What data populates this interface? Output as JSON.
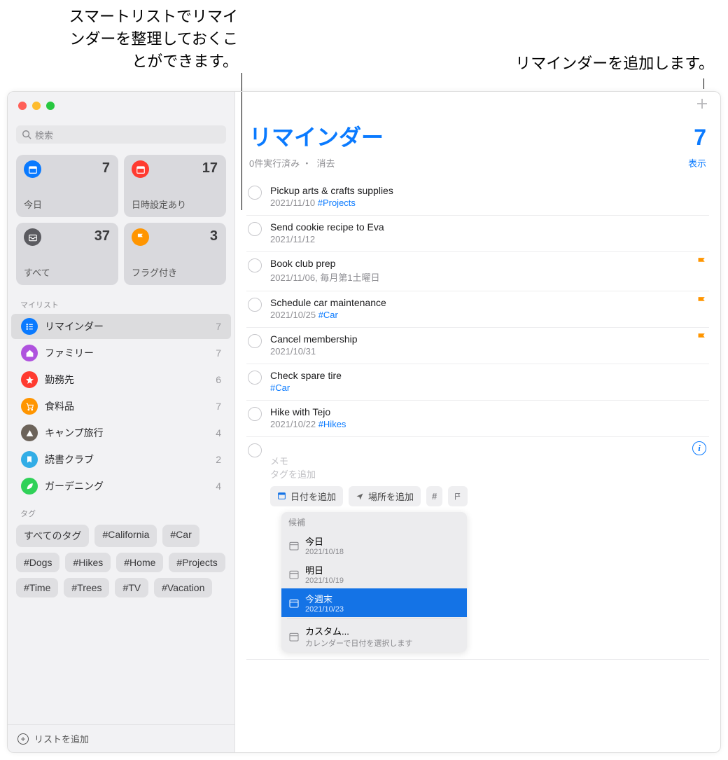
{
  "callouts": {
    "left": "スマートリストでリマインダーを整理しておくことができます。",
    "right": "リマインダーを追加します。"
  },
  "sidebar": {
    "search_placeholder": "検索",
    "smart": [
      {
        "label": "今日",
        "count": 7,
        "icon": "calendar",
        "color": "bg-blue"
      },
      {
        "label": "日時設定あり",
        "count": 17,
        "icon": "calendar",
        "color": "bg-red"
      },
      {
        "label": "すべて",
        "count": 37,
        "icon": "tray",
        "color": "bg-gray"
      },
      {
        "label": "フラグ付き",
        "count": 3,
        "icon": "flag",
        "color": "bg-orange"
      }
    ],
    "mylists_label": "マイリスト",
    "lists": [
      {
        "name": "リマインダー",
        "count": 7,
        "color": "bg-blue",
        "icon": "list",
        "selected": true
      },
      {
        "name": "ファミリー",
        "count": 7,
        "color": "bg-purple",
        "icon": "house"
      },
      {
        "name": "勤務先",
        "count": 6,
        "color": "bg-red",
        "icon": "star"
      },
      {
        "name": "食料品",
        "count": 7,
        "color": "bg-orange",
        "icon": "cart"
      },
      {
        "name": "キャンプ旅行",
        "count": 4,
        "color": "bg-darkg",
        "icon": "tent"
      },
      {
        "name": "読書クラブ",
        "count": 2,
        "color": "bg-sky",
        "icon": "bookmark"
      },
      {
        "name": "ガーデニング",
        "count": 4,
        "color": "bg-green",
        "icon": "leaf"
      }
    ],
    "tags_label": "タグ",
    "tags": [
      "すべてのタグ",
      "#California",
      "#Car",
      "#Dogs",
      "#Hikes",
      "#Home",
      "#Projects",
      "#Time",
      "#Trees",
      "#TV",
      "#Vacation"
    ],
    "add_list": "リストを追加"
  },
  "main": {
    "title": "リマインダー",
    "count": 7,
    "completed_text": "0件実行済み",
    "clear": "消去",
    "show": "表示",
    "items": [
      {
        "title": "Pickup arts & crafts supplies",
        "sub": "2021/11/10",
        "tag": "#Projects",
        "flag": false
      },
      {
        "title": "Send cookie recipe to Eva",
        "sub": "2021/11/12",
        "tag": "",
        "flag": false
      },
      {
        "title": "Book club prep",
        "sub": "2021/11/06, 毎月第1土曜日",
        "tag": "",
        "flag": true
      },
      {
        "title": "Schedule car maintenance",
        "sub": "2021/10/25",
        "tag": "#Car",
        "flag": true
      },
      {
        "title": "Cancel membership",
        "sub": "2021/10/31",
        "tag": "",
        "flag": true
      },
      {
        "title": "Check spare tire",
        "sub": "",
        "tag": "#Car",
        "flag": false
      },
      {
        "title": "Hike with Tejo",
        "sub": "2021/10/22",
        "tag": "#Hikes",
        "flag": false
      }
    ],
    "new_item": {
      "memo": "メモ",
      "add_tag": "タグを追加",
      "chips": {
        "date": "日付を追加",
        "location": "場所を追加"
      }
    },
    "popover": {
      "header": "候補",
      "rows": [
        {
          "title": "今日",
          "sub": "2021/10/18",
          "sel": false
        },
        {
          "title": "明日",
          "sub": "2021/10/19",
          "sel": false
        },
        {
          "title": "今週末",
          "sub": "2021/10/23",
          "sel": true
        }
      ],
      "custom": {
        "title": "カスタム...",
        "sub": "カレンダーで日付を選択します"
      }
    }
  }
}
